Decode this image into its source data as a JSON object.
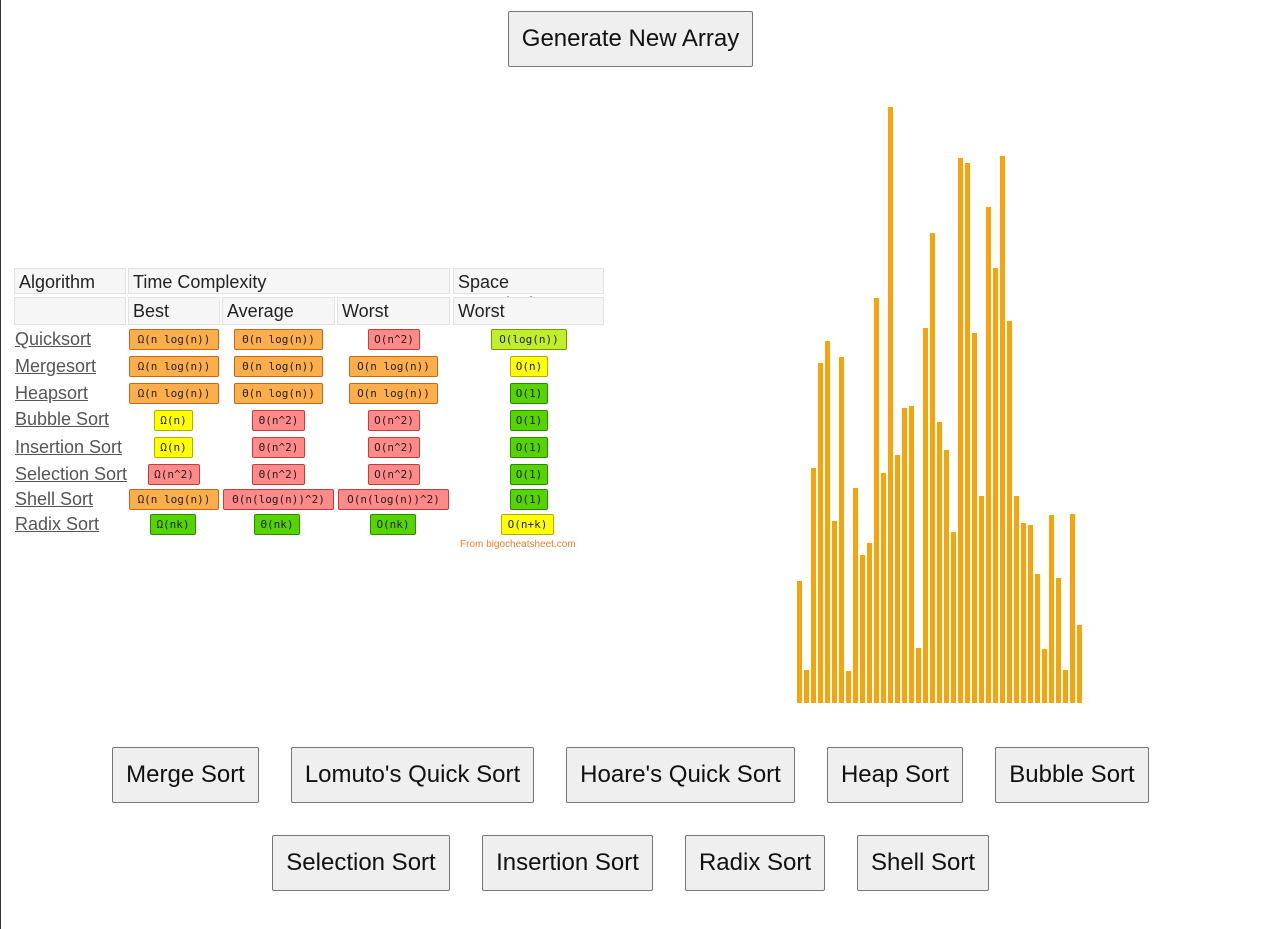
{
  "generate_button": "Generate New Array",
  "table": {
    "header": {
      "algorithm": "Algorithm",
      "time_complexity": "Time Complexity",
      "space_complexity": "Space Complexity"
    },
    "subheader": {
      "best": "Best",
      "average": "Average",
      "worst": "Worst",
      "space_worst": "Worst"
    },
    "rows": [
      {
        "name": "Quicksort",
        "best": "Ω(n log(n))",
        "average": "Θ(n log(n))",
        "worst": "O(n^2)",
        "space": "O(log(n))"
      },
      {
        "name": "Mergesort",
        "best": "Ω(n log(n))",
        "average": "Θ(n log(n))",
        "worst": "O(n log(n))",
        "space": "O(n)"
      },
      {
        "name": "Heapsort",
        "best": "Ω(n log(n))",
        "average": "Θ(n log(n))",
        "worst": "O(n log(n))",
        "space": "O(1)"
      },
      {
        "name": "Bubble Sort",
        "best": "Ω(n)",
        "average": "Θ(n^2)",
        "worst": "O(n^2)",
        "space": "O(1)"
      },
      {
        "name": "Insertion Sort",
        "best": "Ω(n)",
        "average": "Θ(n^2)",
        "worst": "O(n^2)",
        "space": "O(1)"
      },
      {
        "name": "Selection Sort",
        "best": "Ω(n^2)",
        "average": "Θ(n^2)",
        "worst": "O(n^2)",
        "space": "O(1)"
      },
      {
        "name": "Shell Sort",
        "best": "Ω(n log(n))",
        "average": "Θ(n(log(n))^2)",
        "worst": "O(n(log(n))^2)",
        "space": "O(1)"
      },
      {
        "name": "Radix Sort",
        "best": "Ω(nk)",
        "average": "Θ(nk)",
        "worst": "O(nk)",
        "space": "O(n+k)"
      }
    ],
    "credit": "From bigocheatsheet.com"
  },
  "colors": {
    "bar": "#f5a40c",
    "badge_orange": "#fcae4a",
    "badge_red": "#ff8a88",
    "badge_yellow": "#ffff00",
    "badge_green": "#55d400",
    "badge_lime": "#c0ef2a"
  },
  "chart_data": {
    "type": "bar",
    "values": [
      122,
      33,
      235,
      340,
      362,
      182,
      346,
      32,
      215,
      148,
      160,
      405,
      230,
      596,
      248,
      295,
      297,
      55,
      375,
      470,
      281,
      253,
      171,
      545,
      540,
      370,
      207,
      496,
      435,
      547,
      382,
      207,
      180,
      178,
      129,
      54,
      188,
      125,
      33,
      189,
      78
    ]
  },
  "sort_buttons": {
    "merge": "Merge Sort",
    "lomuto": "Lomuto's Quick Sort",
    "hoare": "Hoare's Quick Sort",
    "heap": "Heap Sort",
    "bubble": "Bubble Sort",
    "selection": "Selection Sort",
    "insertion": "Insertion Sort",
    "radix": "Radix Sort",
    "shell": "Shell Sort"
  }
}
